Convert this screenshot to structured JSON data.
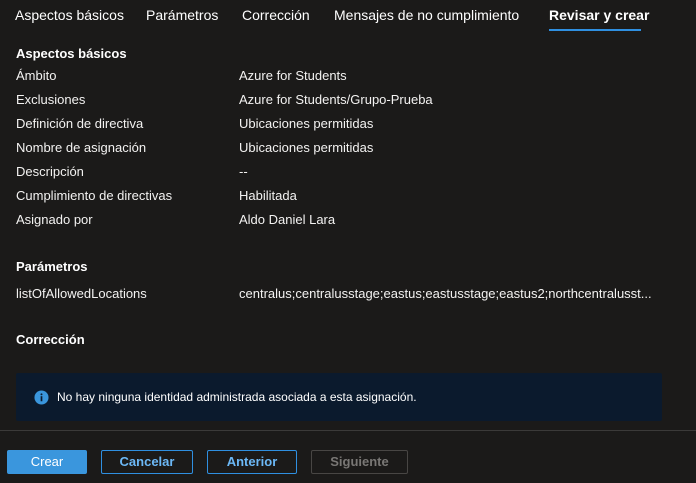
{
  "tabs": [
    {
      "label": "Aspectos básicos"
    },
    {
      "label": "Parámetros"
    },
    {
      "label": "Corrección"
    },
    {
      "label": "Mensajes de no cumplimiento"
    },
    {
      "label": "Revisar y crear",
      "active": true
    }
  ],
  "basics": {
    "heading": "Aspectos básicos",
    "rows": [
      {
        "label": "Ámbito",
        "value": "Azure for Students"
      },
      {
        "label": "Exclusiones",
        "value": "Azure for Students/Grupo-Prueba"
      },
      {
        "label": "Definición de directiva",
        "value": "Ubicaciones permitidas"
      },
      {
        "label": "Nombre de asignación",
        "value": "Ubicaciones permitidas"
      },
      {
        "label": "Descripción",
        "value": "--"
      },
      {
        "label": "Cumplimiento de directivas",
        "value": "Habilitada"
      },
      {
        "label": "Asignado por",
        "value": "Aldo Daniel Lara"
      }
    ]
  },
  "parameters": {
    "heading": "Parámetros",
    "rows": [
      {
        "label": "listOfAllowedLocations",
        "value": "centralus;centralusstage;eastus;eastusstage;eastus2;northcentralusst..."
      }
    ]
  },
  "remediation": {
    "heading": "Corrección",
    "info_text": "No hay ninguna identidad administrada asociada a esta asignación.",
    "info_icon": "info-icon"
  },
  "footer": {
    "create_label": "Crear",
    "cancel_label": "Cancelar",
    "previous_label": "Anterior",
    "next_label": "Siguiente"
  },
  "colors": {
    "background": "#1b1a19",
    "accent": "#2f8fe0",
    "primary_button": "#3a96dd",
    "info_background": "#0b1a2d"
  }
}
